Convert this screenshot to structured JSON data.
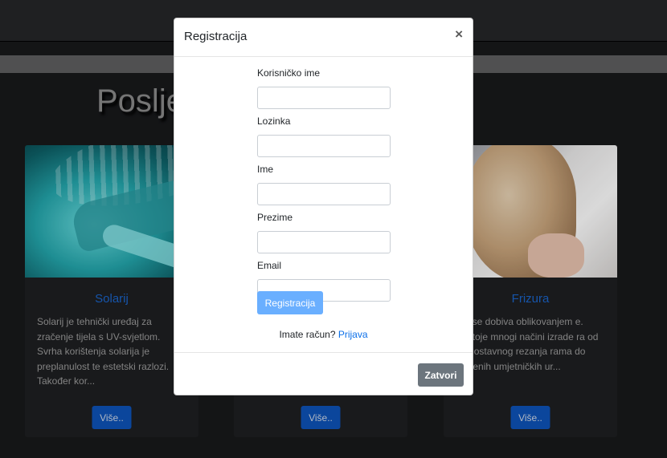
{
  "page": {
    "heading": "Poslje",
    "cards": [
      {
        "title": "Solarij",
        "text": "Solarij je tehnički uređaj za zračenje tijela s UV-svjetlom. Svrha korištenja solarija je preplanulost te estetski razlozi. Također kor...",
        "button": "Više.."
      },
      {
        "title": "",
        "text": "",
        "button": "Više.."
      },
      {
        "title": "Frizura",
        "text": "ura se dobiva oblikovanjem e. Postoje mnogi načini izrade ra od jednostavnog rezanja rama do složenih umjetničkih ur...",
        "button": "Više.."
      }
    ]
  },
  "modal": {
    "title": "Registracija",
    "close_symbol": "×",
    "fields": [
      {
        "label": "Korisničko ime",
        "value": ""
      },
      {
        "label": "Lozinka",
        "value": ""
      },
      {
        "label": "Ime",
        "value": ""
      },
      {
        "label": "Prezime",
        "value": ""
      },
      {
        "label": "Email",
        "value": ""
      }
    ],
    "submit_label": "Registracija",
    "login_prompt": "Imate račun?",
    "login_link": "Prijava",
    "close_label": "Zatvori"
  }
}
